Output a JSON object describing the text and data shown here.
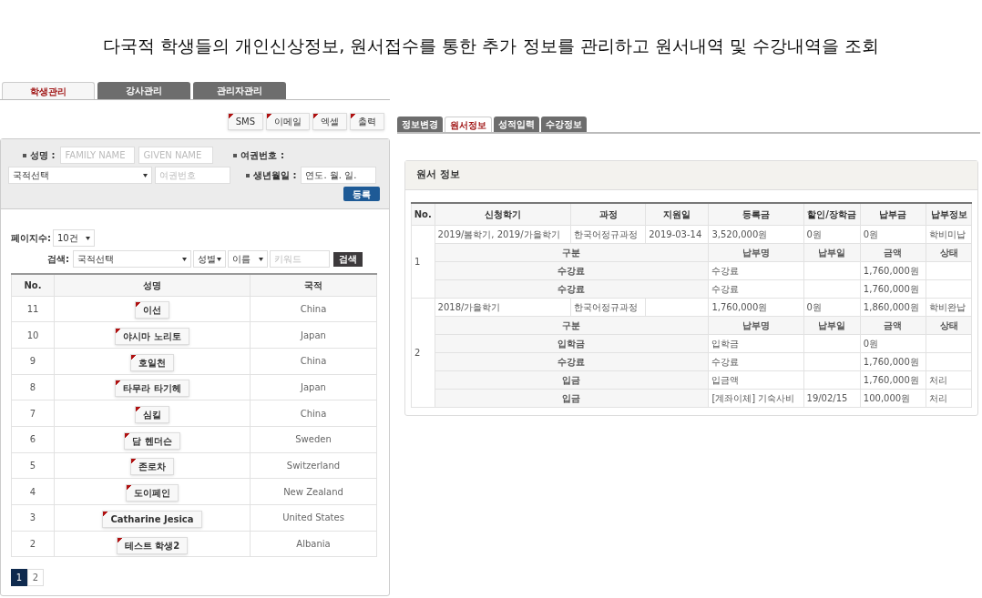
{
  "headline": "다국적 학생들의 개인신상정보, 원서접수를 통한 추가 정보를 관리하고 원서내역 및 수강내역을 조회",
  "main_tabs": [
    {
      "label": "학생관리",
      "selected": true
    },
    {
      "label": "강사관리",
      "selected": false
    },
    {
      "label": "관리자관리",
      "selected": false
    }
  ],
  "action_buttons": [
    "SMS",
    "이메일",
    "엑셀",
    "출력"
  ],
  "registration_form": {
    "name_label": "성명 :",
    "family_name_placeholder": "FAMILY NAME",
    "given_name_placeholder": "GIVEN NAME",
    "passport_label": "여권번호 :",
    "nationality_select": "국적선택",
    "passport_placeholder": "여권번호",
    "birth_label": "생년월일 :",
    "birth_value": "연도. 월. 일.",
    "submit": "등록"
  },
  "list_controls": {
    "page_size_label": "페이지수:",
    "page_size": "10건",
    "search_label": "검색:",
    "nationality": "국적선택",
    "gender": "성별",
    "field": "이름",
    "keyword_placeholder": "키워드",
    "search_button": "검색"
  },
  "students": {
    "columns": [
      "No.",
      "성명",
      "국적"
    ],
    "rows": [
      {
        "no": "11",
        "name": "이선",
        "nationality": "China"
      },
      {
        "no": "10",
        "name": "야시마 노리토",
        "nationality": "Japan"
      },
      {
        "no": "9",
        "name": "호일천",
        "nationality": "China"
      },
      {
        "no": "8",
        "name": "타무라 타기헤",
        "nationality": "Japan"
      },
      {
        "no": "7",
        "name": "심킬",
        "nationality": "China"
      },
      {
        "no": "6",
        "name": "담 헨더슨",
        "nationality": "Sweden"
      },
      {
        "no": "5",
        "name": "존로차",
        "nationality": "Switzerland"
      },
      {
        "no": "4",
        "name": "도이페인",
        "nationality": "New Zealand"
      },
      {
        "no": "3",
        "name": "Catharine Jesica",
        "nationality": "United States"
      },
      {
        "no": "2",
        "name": "테스트 학생2",
        "nationality": "Albania"
      }
    ]
  },
  "pagination": [
    {
      "label": "1",
      "selected": true
    },
    {
      "label": "2",
      "selected": false
    }
  ],
  "detail_tabs": [
    {
      "label": "정보변경",
      "selected": false
    },
    {
      "label": "원서정보",
      "selected": true
    },
    {
      "label": "성적입력",
      "selected": false
    },
    {
      "label": "수강정보",
      "selected": false
    }
  ],
  "application_info": {
    "title": "원서 정보",
    "columns": [
      "No.",
      "신청학기",
      "과정",
      "지원일",
      "등록금",
      "할인/장학금",
      "납부금",
      "납부정보"
    ],
    "entries": [
      {
        "no": "1",
        "term": "2019/봄학기, 2019/가을학기",
        "course": "한국어정규과정",
        "date": "2019-03-14",
        "tuition": "3,520,000원",
        "discount": "0원",
        "paid": "0원",
        "payment_status": "학비미납",
        "sub_columns": [
          "구분",
          "납부명",
          "납부일",
          "금액",
          "상태"
        ],
        "payments": [
          {
            "type": "수강료",
            "name": "수강료",
            "amount": "1,760,000원"
          },
          {
            "type": "수강료",
            "name": "수강료",
            "amount": "1,760,000원"
          }
        ]
      },
      {
        "no": "2",
        "term": "2018/가을학기",
        "course": "한국어정규과정",
        "tuition": "1,760,000원",
        "discount": "0원",
        "paid": "1,860,000원",
        "payment_status": "학비완납",
        "sub_columns": [
          "구분",
          "납부명",
          "납부일",
          "금액",
          "상태"
        ],
        "payments": [
          {
            "type": "입학금",
            "name": "입학금",
            "amount": "0원"
          },
          {
            "type": "수강료",
            "name": "수강료",
            "amount": "1,760,000원"
          },
          {
            "type": "입금",
            "name": "입금액",
            "amount": "1,760,000원",
            "status": "처리"
          },
          {
            "type": "입금",
            "name": "[계좌이체] 기숙사비",
            "date": "19/02/15",
            "amount": "100,000원",
            "status": "처리"
          }
        ]
      }
    ]
  }
}
